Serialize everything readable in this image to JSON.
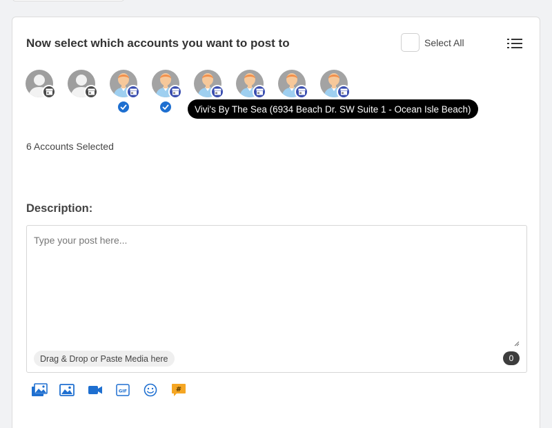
{
  "header": {
    "title": "Now select which accounts you want to post to",
    "select_all_label": "Select All"
  },
  "accounts": [
    {
      "type": "default",
      "selected": false
    },
    {
      "type": "default",
      "selected": false
    },
    {
      "type": "person",
      "selected": true
    },
    {
      "type": "person",
      "selected": true
    },
    {
      "type": "person",
      "selected": false
    },
    {
      "type": "person",
      "selected": false
    },
    {
      "type": "person",
      "selected": false
    },
    {
      "type": "person",
      "selected": false
    }
  ],
  "tooltip": {
    "text": "Vivi's By The Sea (6934 Beach Dr. SW Suite 1 - Ocean Isle Beach)"
  },
  "summary": {
    "selected_text": "6 Accounts Selected"
  },
  "description": {
    "label": "Description:",
    "placeholder": "Type your post here...",
    "value": "",
    "drop_hint": "Drag & Drop or Paste Media here",
    "char_count": "0"
  },
  "toolbar": [
    {
      "icon": "gallery-icon"
    },
    {
      "icon": "image-icon"
    },
    {
      "icon": "video-icon"
    },
    {
      "icon": "gif-icon"
    },
    {
      "icon": "emoji-icon"
    },
    {
      "icon": "hashtag-icon"
    }
  ],
  "colors": {
    "accent": "#1e6fd0",
    "badge_blue": "#3b4fb0",
    "badge_gray": "#4a4a4a",
    "hashtag_orange": "#f5a623"
  }
}
